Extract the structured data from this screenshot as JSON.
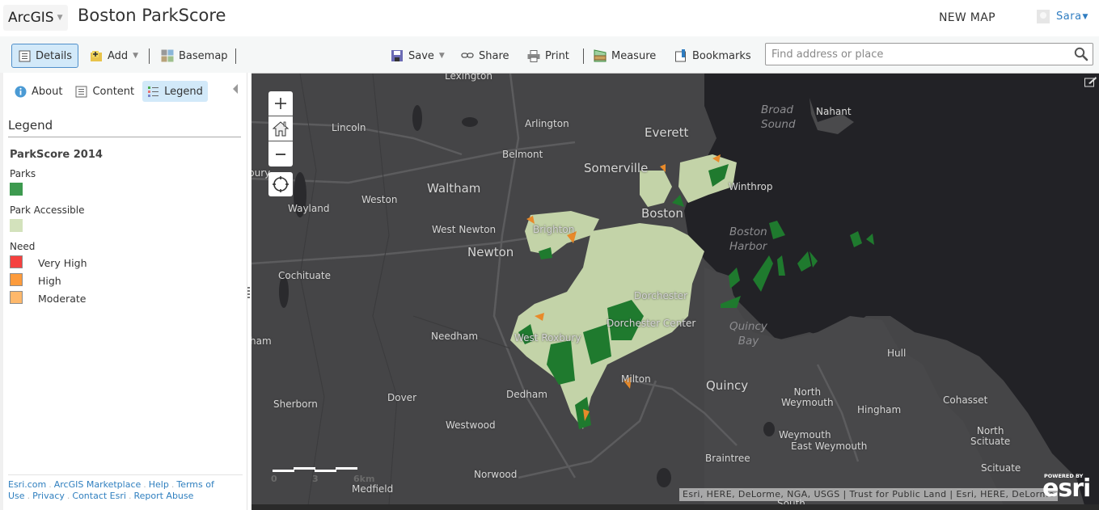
{
  "header": {
    "app_menu": "ArcGIS",
    "map_title": "Boston ParkScore",
    "new_map": "NEW MAP",
    "user_name": "Sara"
  },
  "toolbar": {
    "details": "Details",
    "add": "Add",
    "basemap": "Basemap",
    "save": "Save",
    "share": "Share",
    "print": "Print",
    "measure": "Measure",
    "bookmarks": "Bookmarks",
    "search_placeholder": "Find address or place",
    "search_value": ""
  },
  "panel": {
    "tabs": [
      {
        "label": "About",
        "icon": "info-icon"
      },
      {
        "label": "Content",
        "icon": "content-icon"
      },
      {
        "label": "Legend",
        "icon": "legend-icon",
        "active": true
      }
    ],
    "legend_title": "Legend",
    "layer_title": "ParkScore 2014",
    "groups": {
      "parks": {
        "label": "Parks",
        "color": "#3d9a4f"
      },
      "accessible": {
        "label": "Park Accessible",
        "color": "#d3e2bc"
      },
      "need": {
        "label": "Need",
        "items": [
          {
            "label": "Very High",
            "color": "#f5413f"
          },
          {
            "label": "High",
            "color": "#fd9b3c"
          },
          {
            "label": "Moderate",
            "color": "#feb86b"
          }
        ]
      }
    },
    "footer_links": [
      "Esri.com",
      "ArcGIS Marketplace",
      "Help",
      "Terms of Use",
      "Privacy",
      "Contact Esri",
      "Report Abuse"
    ]
  },
  "map": {
    "places": {
      "lexington": "Lexington",
      "lincoln": "Lincoln",
      "arlington": "Arlington",
      "everett": "Everett",
      "belmont": "Belmont",
      "somerville": "Somerville",
      "waltham": "Waltham",
      "weston": "Weston",
      "wayland": "Wayland",
      "sudbury": "bury",
      "winthrop": "Winthrop",
      "nahant": "Nahant",
      "boston": "Boston",
      "brighton": "Brighton",
      "west_newton": "West Newton",
      "newton": "Newton",
      "cochituate": "Cochituate",
      "dorchester": "Dorchester",
      "dorchester_center": "Dorchester Center",
      "west_roxbury": "West Roxbury",
      "needham": "Needham",
      "framingham": "ham",
      "milton": "Milton",
      "dedham": "Dedham",
      "quincy": "Quincy",
      "hull": "Hull",
      "north_weymouth": "North\nWeymouth",
      "hingham": "Hingham",
      "cohasset": "Cohasset",
      "sherborn": "Sherborn",
      "dover": "Dover",
      "westwood": "Westwood",
      "weymouth": "Weymouth",
      "east_weymouth": "East Weymouth",
      "north_scituate": "North\nScituate",
      "braintree": "Braintree",
      "scituate": "Scituate",
      "norwood": "Norwood",
      "medfield": "Medfield",
      "south": "South"
    },
    "water": {
      "broad_sound": "Broad\nSound",
      "boston_harbor": "Boston\nHarbor",
      "quincy_bay": "Quincy\nBay"
    },
    "scale_labels": [
      "0",
      "3",
      "6km"
    ],
    "attribution": "Esri, HERE, DeLorme, NGA, USGS | Trust for Public Land | Esri, HERE, DeLorme",
    "logo_powered": "POWERED BY",
    "logo_word": "esri"
  }
}
